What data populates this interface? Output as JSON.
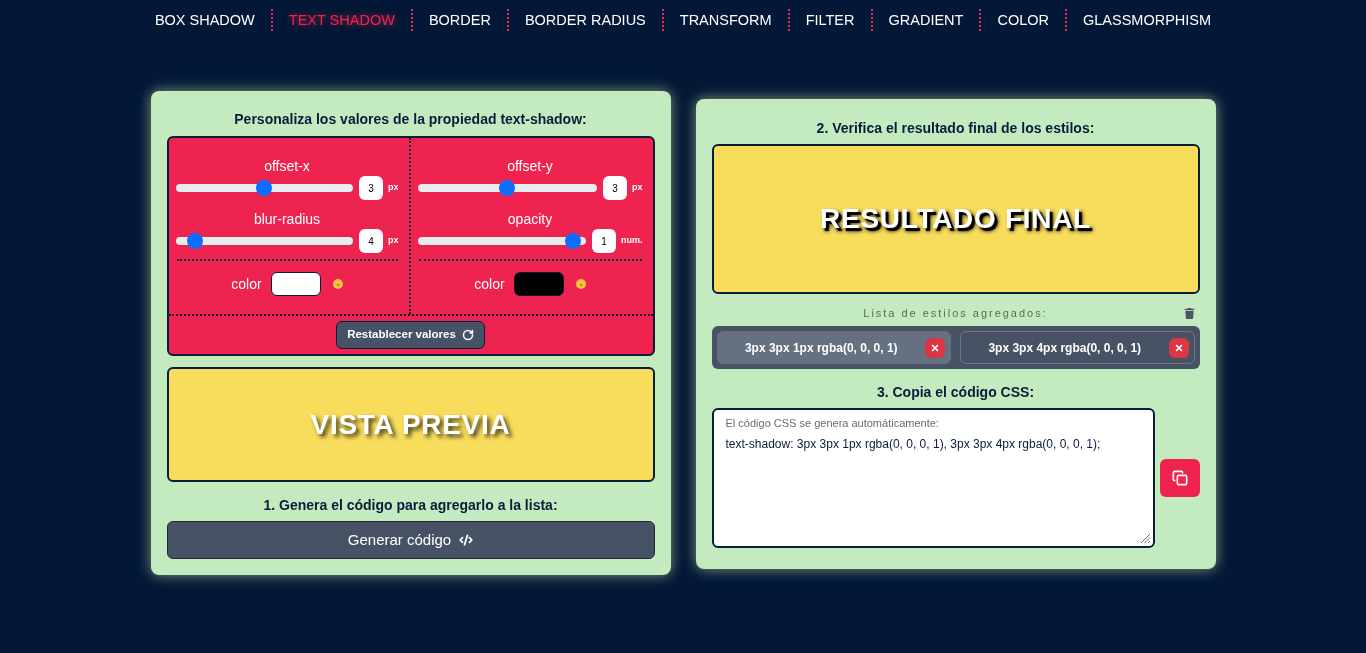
{
  "nav": {
    "items": [
      {
        "label": "BOX SHADOW",
        "selected": false
      },
      {
        "label": "TEXT SHADOW",
        "selected": true
      },
      {
        "label": "BORDER",
        "selected": false
      },
      {
        "label": "BORDER RADIUS",
        "selected": false
      },
      {
        "label": "TRANSFORM",
        "selected": false
      },
      {
        "label": "FILTER",
        "selected": false
      },
      {
        "label": "GRADIENT",
        "selected": false
      },
      {
        "label": "COLOR",
        "selected": false
      },
      {
        "label": "GLASSMORPHISM",
        "selected": false
      }
    ]
  },
  "editor": {
    "title": "Personaliza los valores de la propiedad text-shadow:",
    "columns": [
      {
        "sliders": [
          {
            "label": "offset-x",
            "level": 0.5,
            "value": "3",
            "unit": "px"
          },
          {
            "label": "blur-radius",
            "level": 0.07,
            "value": "4",
            "unit": "px"
          }
        ],
        "color_picker": {
          "label": "color",
          "color": "#ffffff"
        }
      },
      {
        "sliders": [
          {
            "label": "offset-y",
            "level": 0.5,
            "value": "3",
            "unit": "px"
          },
          {
            "label": "opacity",
            "level": 0.97,
            "value": "1",
            "unit": "num."
          }
        ],
        "color_picker": {
          "label": "color",
          "color": "#000000"
        }
      }
    ],
    "reset_button": "Restablecer valores"
  },
  "preview": {
    "text": "VISTA PREVIA"
  },
  "generate": {
    "label": "1. Genera el código para agregarlo a la lista:",
    "button": "Generar código"
  },
  "result": {
    "heading": "2. Verifica el resultado final de los estilos:",
    "text": "RESULTADO FINAL"
  },
  "styles_list": {
    "label": "Lista de estilos agregados:",
    "items": [
      {
        "text": "3px 3px 1px rgba(0, 0, 0, 1)",
        "selected": true
      },
      {
        "text": "3px 3px 4px rgba(0, 0, 0, 1)",
        "selected": false
      }
    ]
  },
  "css_output": {
    "heading": "3. Copia el código CSS:",
    "field_label": "El código CSS se genera automáticamente:",
    "value": "text-shadow: 3px 3px 1px rgba(0, 0, 0, 1), 3px 3px 4px rgba(0, 0, 0, 1);"
  }
}
